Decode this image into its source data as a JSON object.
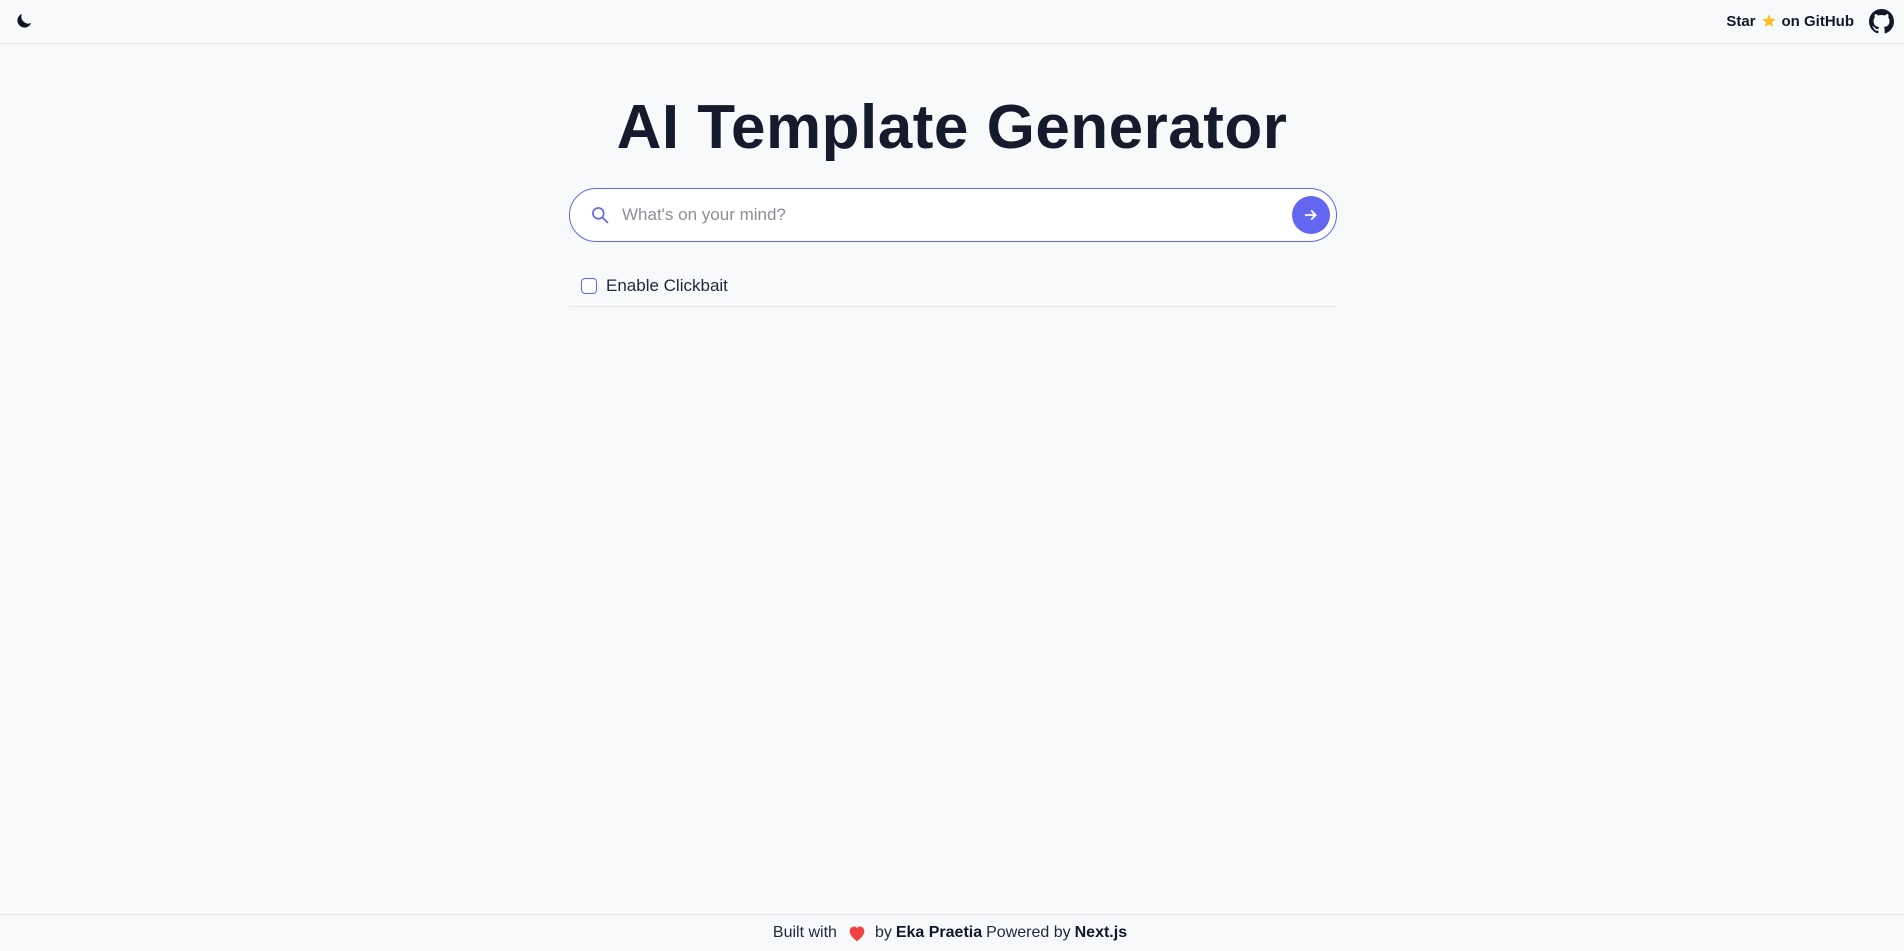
{
  "header": {
    "theme_toggle_icon": "moon-icon",
    "github_star": {
      "prefix": "Star",
      "star_icon": "star-icon",
      "suffix": "on GitHub"
    },
    "github_icon": "github-icon"
  },
  "main": {
    "title": "AI Template Generator",
    "search": {
      "placeholder": "What's on your mind?",
      "value": "",
      "icon": "search-icon",
      "submit_icon": "arrow-right-icon"
    },
    "options": [
      {
        "label": "Enable Clickbait",
        "checked": false
      }
    ]
  },
  "footer": {
    "built_with": "Built with",
    "heart_icon": "heart-icon",
    "by": "by",
    "author": "Eka Praetia",
    "powered_by": "Powered by",
    "framework": "Next.js"
  },
  "colors": {
    "accent": "#6366f1",
    "background": "#f8f9fb",
    "text": "#111827",
    "heart": "#ef4444",
    "star": "#fbbf24"
  }
}
